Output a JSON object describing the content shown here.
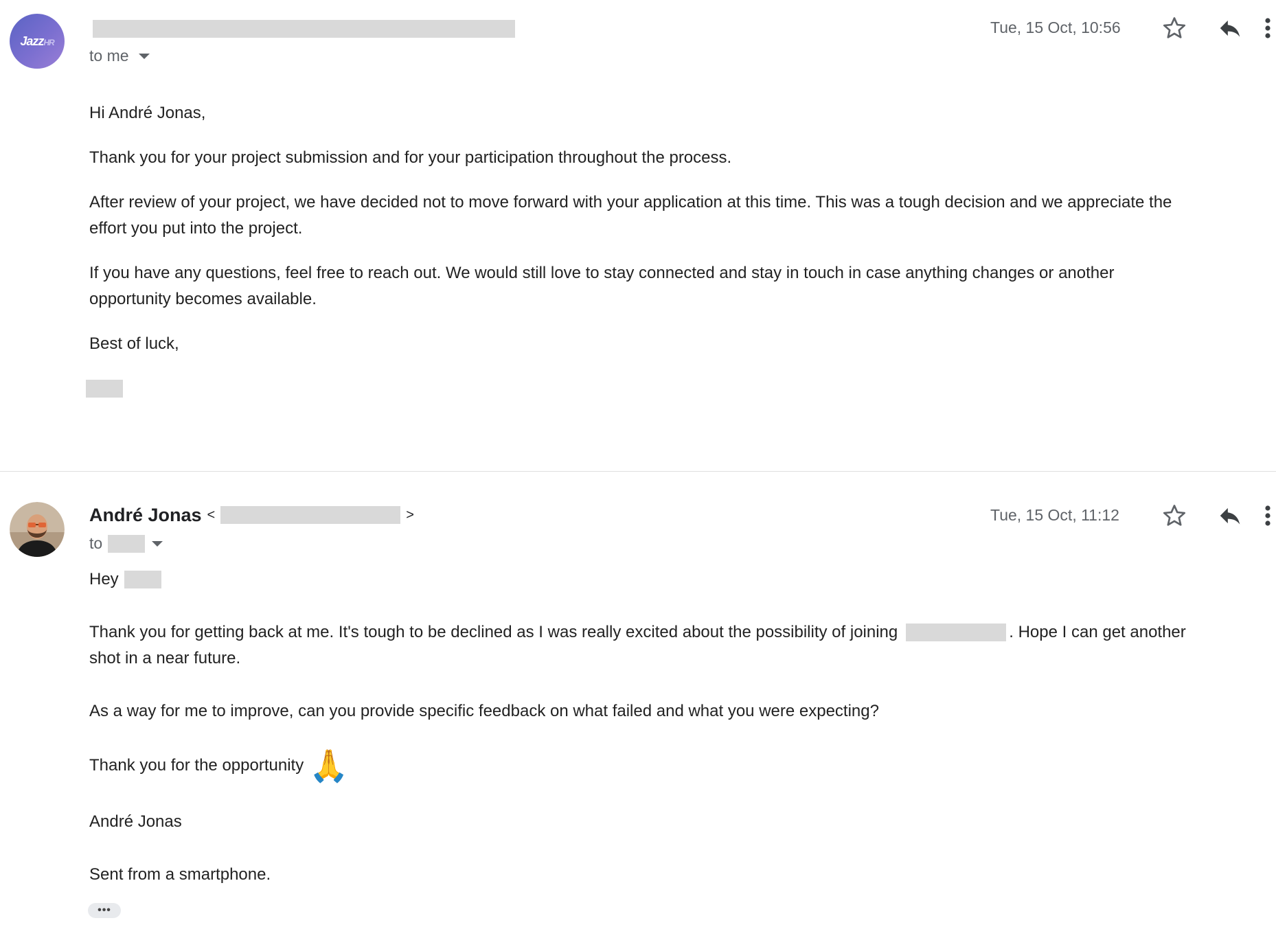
{
  "message1": {
    "avatar": {
      "logo_main": "Jazz",
      "logo_suffix": "HR"
    },
    "recipient_label": "to me",
    "date": "Tue, 15 Oct, 10:56",
    "body": {
      "greeting": "Hi André Jonas,",
      "p1": "Thank you for your project submission and for your participation throughout the process.",
      "p2_line1": "After review of your project, we have decided not to move forward with your application at this time. This was a tough decision and we appreciate the",
      "p2_line2": "effort you put into the project.",
      "p3_line1": "If you have any questions, feel free to reach out. We would still love to stay connected and stay in touch in case anything changes or another",
      "p3_line2": "opportunity becomes available.",
      "closing": "Best of luck,"
    }
  },
  "message2": {
    "sender_name": "André Jonas",
    "bracket_open": "<",
    "bracket_close": ">",
    "recipient_prefix": "to",
    "date": "Tue, 15 Oct, 11:12",
    "body": {
      "greeting": "Hey",
      "p1_line1_a": "Thank you for getting back at me. It's tough to be declined as I was really excited about the possibility of joining",
      "p1_line1_b": ". Hope I can get another",
      "p1_line2": "shot in a near future.",
      "p2": "As a way for me to improve, can you provide specific feedback on what failed and what you were expecting?",
      "p3": "Thank you for the opportunity",
      "emoji": "🙏",
      "signature": "André Jonas",
      "footer": "Sent from a smartphone.",
      "trimmed_content": "•••"
    }
  },
  "icons": [
    "star-icon",
    "reply-icon",
    "more-vert-icon",
    "dropdown-arrow-icon"
  ],
  "colors": {
    "accent_avatar": "#6b6bcc",
    "muted_text": "#5f6368",
    "redaction": "#d9d9d9"
  }
}
